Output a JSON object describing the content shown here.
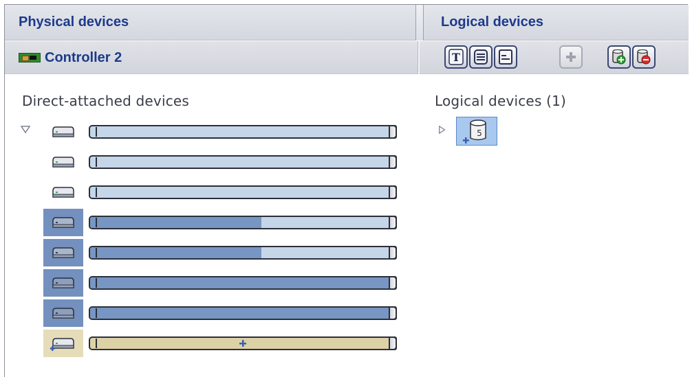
{
  "header": {
    "physical_title": "Physical devices",
    "logical_title": "Logical devices"
  },
  "toolbar": {
    "controller_label": "Controller 2",
    "controller_icon": "controller-card-icon",
    "buttons": [
      {
        "name": "text-view-button",
        "icon": "text-view-icon",
        "enabled": true
      },
      {
        "name": "full-size-view-button",
        "icon": "full-size-view-icon",
        "enabled": true
      },
      {
        "name": "relative-size-view-button",
        "icon": "relative-size-view-icon",
        "enabled": true
      },
      {
        "name": "create-logical-device-button",
        "icon": "plus-icon",
        "enabled": false
      },
      {
        "name": "add-hot-spare-button",
        "icon": "disk-add-icon",
        "enabled": true
      },
      {
        "name": "remove-hot-spare-button",
        "icon": "disk-remove-icon",
        "enabled": true
      }
    ]
  },
  "physical": {
    "section_label": "Direct-attached devices",
    "expanded": true,
    "devices": [
      {
        "state": "available",
        "used_fraction": 0.0
      },
      {
        "state": "available",
        "used_fraction": 0.0
      },
      {
        "state": "available",
        "used_fraction": 0.0
      },
      {
        "state": "assigned-partial",
        "used_fraction": 0.56
      },
      {
        "state": "assigned-partial",
        "used_fraction": 0.56
      },
      {
        "state": "assigned",
        "used_fraction": 1.0
      },
      {
        "state": "assigned",
        "used_fraction": 1.0
      },
      {
        "state": "hot-spare",
        "used_fraction": 0.0
      }
    ]
  },
  "logical": {
    "section_label": "Logical devices (1)",
    "expanded": false,
    "devices": [
      {
        "raid_level": "5",
        "icon": "raid5-logical-drive-icon"
      }
    ]
  },
  "colors": {
    "title_blue": "#1d3a8a",
    "bar_free": "#c6d6e9",
    "bar_used": "#7896c4",
    "assigned_cell": "#7390be",
    "spare": "#ddd1a6",
    "selection": "#a9c8ee"
  }
}
